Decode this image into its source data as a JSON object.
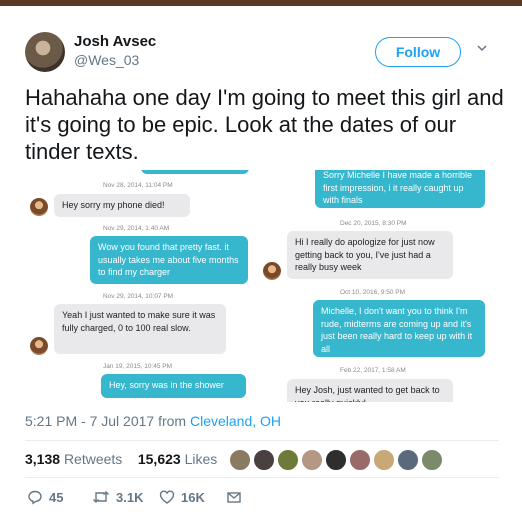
{
  "user": {
    "name": "Josh Avsec",
    "handle": "@Wes_03"
  },
  "follow_label": "Follow",
  "tweet_text": "Hahahaha one day I'm going to meet this girl and it's going to be epic. Look at the dates of our tinder texts.",
  "conversation": {
    "left": {
      "ts1": "Nov 28, 2014, 11:04 PM",
      "m1": "Hey sorry my phone died!",
      "ts2": "Nov 29, 2014, 1:40 AM",
      "m2": "Wow you found that pretty fast. it usually takes me about  five months to find my charger",
      "ts3": "Nov 29, 2014, 10:07 PM",
      "m3": "Yeah I just wanted to make sure it was fully charged, 0 to 100 real slow.",
      "ts4": "Jan 19, 2015, 10:45 PM",
      "m4": "Hey, sorry was in the shower"
    },
    "right": {
      "m1": "Sorry Michelle I have made a horrible first impression, i it really caught up with finals",
      "ts1": "Dec 20, 2015, 8:30 PM",
      "m2": "Hi I really do apologize for just now getting back to you, I've just had a really busy week",
      "ts2": "Oct 10, 2016, 9:50 PM",
      "m3": "Michelle, I don't want you to think I'm rude, midterms are coming up and it's just been really hard to keep up with it all",
      "ts3": "Feb 22, 2017, 1:58 AM",
      "m4": "Hey Josh, just wanted to get back to you really quickly!"
    }
  },
  "meta": {
    "time": "5:21 PM - 7 Jul 2017 from ",
    "location": "Cleveland, OH"
  },
  "stats": {
    "retweets_count": "3,138",
    "retweets_label": "Retweets",
    "likes_count": "15,623",
    "likes_label": "Likes"
  },
  "actions": {
    "replies": "45",
    "retweets": "3.1K",
    "likes": "16K"
  },
  "colors": {
    "accent": "#1da1f2",
    "bubble_out": "#36b7ce",
    "bubble_in": "#e9e9ec",
    "muted": "#657786"
  },
  "icons": [
    "chevron-down-icon",
    "reply-icon",
    "retweet-icon",
    "heart-icon",
    "message-icon"
  ]
}
